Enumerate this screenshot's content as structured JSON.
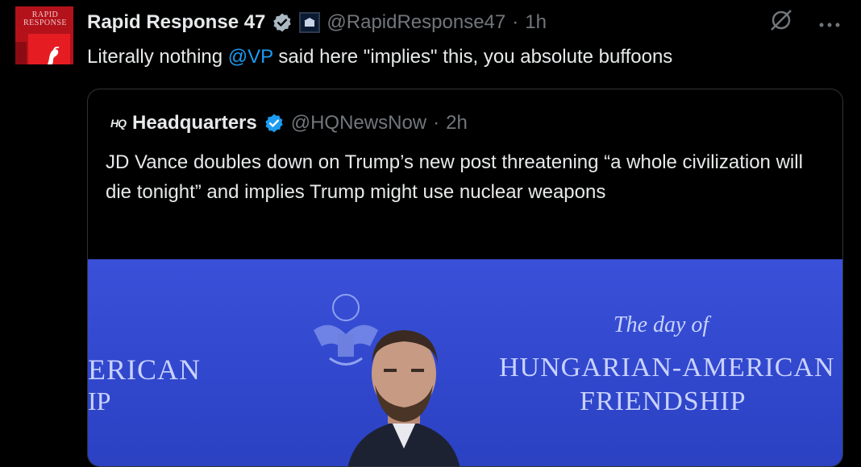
{
  "post": {
    "avatar_text": "RAPID RESPONSE",
    "author_name": "Rapid Response 47",
    "handle": "@RapidResponse47",
    "separator": "·",
    "time": "1h",
    "text_before": "Literally nothing ",
    "mention": "@VP",
    "text_after": " said here \"implies\" this, you absolute buffoons"
  },
  "quoted": {
    "logo": "HQ",
    "author_name": "Headquarters",
    "handle": "@HQNewsNow",
    "separator": "·",
    "time": "2h",
    "text": "JD Vance doubles down on Trump’s new post threatening “a whole civilization will die tonight” and implies Trump might use nuclear weapons",
    "media": {
      "left_text_1": "ERICAN",
      "left_text_2": "IP",
      "script_text": "The day of",
      "banner_line_1": "HUNGARIAN-AMERICAN",
      "banner_line_2": "FRIENDSHIP"
    }
  },
  "icons": {
    "verified": "verified-badge-icon",
    "grok": "grok-icon",
    "more": "more-icon"
  },
  "colors": {
    "background": "#000000",
    "accent": "#1d9bf0",
    "muted": "#71767b",
    "media_blue": "#3047cc"
  }
}
